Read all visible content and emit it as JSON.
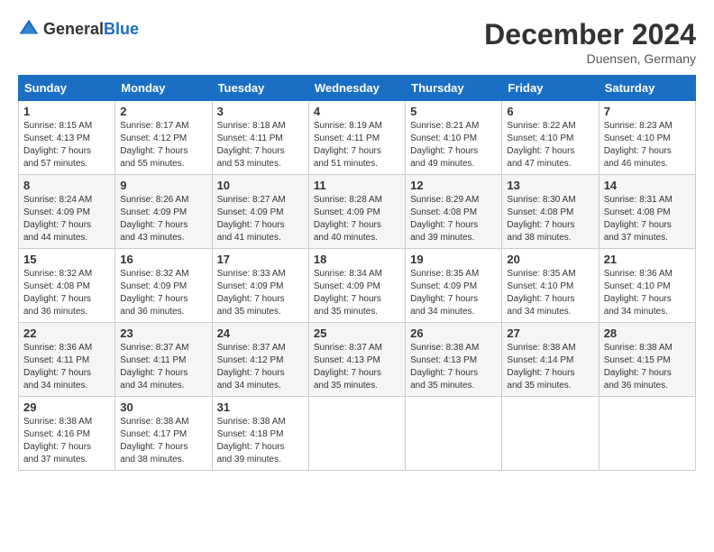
{
  "header": {
    "logo_general": "General",
    "logo_blue": "Blue",
    "month_title": "December 2024",
    "location": "Duensen, Germany"
  },
  "weekdays": [
    "Sunday",
    "Monday",
    "Tuesday",
    "Wednesday",
    "Thursday",
    "Friday",
    "Saturday"
  ],
  "weeks": [
    [
      {
        "day": "1",
        "sunrise": "8:15 AM",
        "sunset": "4:13 PM",
        "daylight": "7 hours and 57 minutes."
      },
      {
        "day": "2",
        "sunrise": "8:17 AM",
        "sunset": "4:12 PM",
        "daylight": "7 hours and 55 minutes."
      },
      {
        "day": "3",
        "sunrise": "8:18 AM",
        "sunset": "4:11 PM",
        "daylight": "7 hours and 53 minutes."
      },
      {
        "day": "4",
        "sunrise": "8:19 AM",
        "sunset": "4:11 PM",
        "daylight": "7 hours and 51 minutes."
      },
      {
        "day": "5",
        "sunrise": "8:21 AM",
        "sunset": "4:10 PM",
        "daylight": "7 hours and 49 minutes."
      },
      {
        "day": "6",
        "sunrise": "8:22 AM",
        "sunset": "4:10 PM",
        "daylight": "7 hours and 47 minutes."
      },
      {
        "day": "7",
        "sunrise": "8:23 AM",
        "sunset": "4:10 PM",
        "daylight": "7 hours and 46 minutes."
      }
    ],
    [
      {
        "day": "8",
        "sunrise": "8:24 AM",
        "sunset": "4:09 PM",
        "daylight": "7 hours and 44 minutes."
      },
      {
        "day": "9",
        "sunrise": "8:26 AM",
        "sunset": "4:09 PM",
        "daylight": "7 hours and 43 minutes."
      },
      {
        "day": "10",
        "sunrise": "8:27 AM",
        "sunset": "4:09 PM",
        "daylight": "7 hours and 41 minutes."
      },
      {
        "day": "11",
        "sunrise": "8:28 AM",
        "sunset": "4:09 PM",
        "daylight": "7 hours and 40 minutes."
      },
      {
        "day": "12",
        "sunrise": "8:29 AM",
        "sunset": "4:08 PM",
        "daylight": "7 hours and 39 minutes."
      },
      {
        "day": "13",
        "sunrise": "8:30 AM",
        "sunset": "4:08 PM",
        "daylight": "7 hours and 38 minutes."
      },
      {
        "day": "14",
        "sunrise": "8:31 AM",
        "sunset": "4:08 PM",
        "daylight": "7 hours and 37 minutes."
      }
    ],
    [
      {
        "day": "15",
        "sunrise": "8:32 AM",
        "sunset": "4:08 PM",
        "daylight": "7 hours and 36 minutes."
      },
      {
        "day": "16",
        "sunrise": "8:32 AM",
        "sunset": "4:09 PM",
        "daylight": "7 hours and 36 minutes."
      },
      {
        "day": "17",
        "sunrise": "8:33 AM",
        "sunset": "4:09 PM",
        "daylight": "7 hours and 35 minutes."
      },
      {
        "day": "18",
        "sunrise": "8:34 AM",
        "sunset": "4:09 PM",
        "daylight": "7 hours and 35 minutes."
      },
      {
        "day": "19",
        "sunrise": "8:35 AM",
        "sunset": "4:09 PM",
        "daylight": "7 hours and 34 minutes."
      },
      {
        "day": "20",
        "sunrise": "8:35 AM",
        "sunset": "4:10 PM",
        "daylight": "7 hours and 34 minutes."
      },
      {
        "day": "21",
        "sunrise": "8:36 AM",
        "sunset": "4:10 PM",
        "daylight": "7 hours and 34 minutes."
      }
    ],
    [
      {
        "day": "22",
        "sunrise": "8:36 AM",
        "sunset": "4:11 PM",
        "daylight": "7 hours and 34 minutes."
      },
      {
        "day": "23",
        "sunrise": "8:37 AM",
        "sunset": "4:11 PM",
        "daylight": "7 hours and 34 minutes."
      },
      {
        "day": "24",
        "sunrise": "8:37 AM",
        "sunset": "4:12 PM",
        "daylight": "7 hours and 34 minutes."
      },
      {
        "day": "25",
        "sunrise": "8:37 AM",
        "sunset": "4:13 PM",
        "daylight": "7 hours and 35 minutes."
      },
      {
        "day": "26",
        "sunrise": "8:38 AM",
        "sunset": "4:13 PM",
        "daylight": "7 hours and 35 minutes."
      },
      {
        "day": "27",
        "sunrise": "8:38 AM",
        "sunset": "4:14 PM",
        "daylight": "7 hours and 35 minutes."
      },
      {
        "day": "28",
        "sunrise": "8:38 AM",
        "sunset": "4:15 PM",
        "daylight": "7 hours and 36 minutes."
      }
    ],
    [
      {
        "day": "29",
        "sunrise": "8:38 AM",
        "sunset": "4:16 PM",
        "daylight": "7 hours and 37 minutes."
      },
      {
        "day": "30",
        "sunrise": "8:38 AM",
        "sunset": "4:17 PM",
        "daylight": "7 hours and 38 minutes."
      },
      {
        "day": "31",
        "sunrise": "8:38 AM",
        "sunset": "4:18 PM",
        "daylight": "7 hours and 39 minutes."
      },
      null,
      null,
      null,
      null
    ]
  ],
  "labels": {
    "sunrise_prefix": "Sunrise: ",
    "sunset_prefix": "Sunset: ",
    "daylight_prefix": "Daylight: "
  }
}
